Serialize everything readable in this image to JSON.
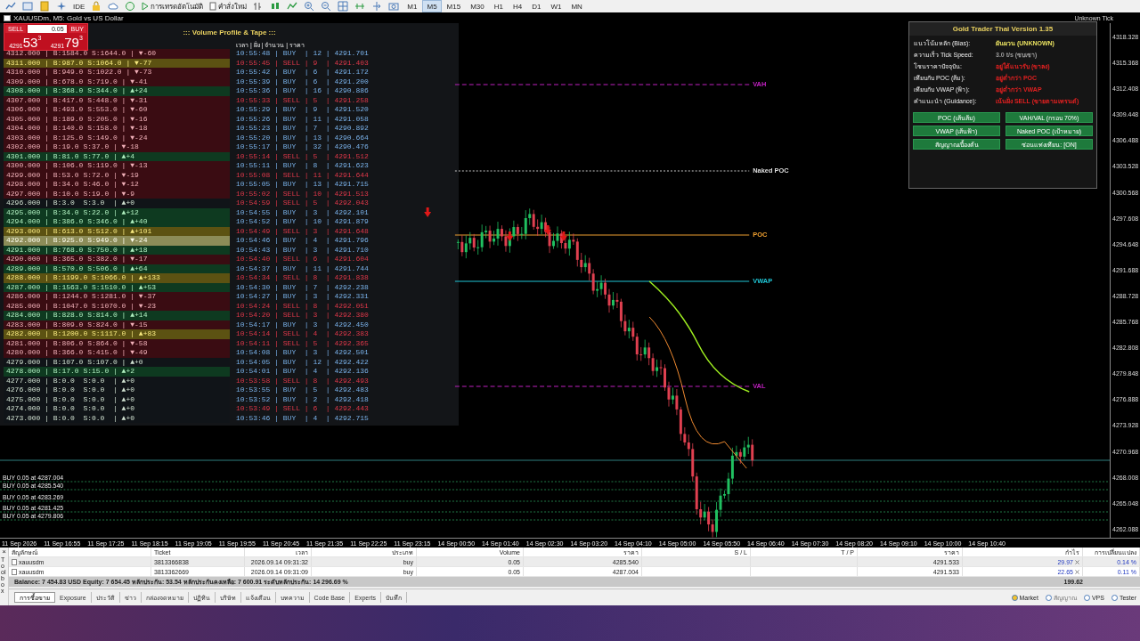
{
  "toolbar": {
    "labeled_buttons": [
      {
        "label": "IDE",
        "kind": "plain"
      },
      {
        "label": "การเทรดอัตโนมัติ",
        "kind": "play"
      },
      {
        "label": "คำสั่งใหม่",
        "kind": "doc"
      }
    ],
    "timeframes": [
      {
        "label": "M1",
        "selected": false
      },
      {
        "label": "M5",
        "selected": true
      },
      {
        "label": "M15",
        "selected": false
      },
      {
        "label": "M30",
        "selected": false
      },
      {
        "label": "H1",
        "selected": false
      },
      {
        "label": "H4",
        "selected": false
      },
      {
        "label": "D1",
        "selected": false
      },
      {
        "label": "W1",
        "selected": false
      },
      {
        "label": "MN",
        "selected": false
      }
    ]
  },
  "chart_window": {
    "title": "XAUUSDm, M5: Gold vs US Dollar",
    "corner_label": "Unknown Tick",
    "one_click": {
      "sell": "SELL",
      "buy": "BUY",
      "volume": "0.05",
      "bid": {
        "big": "4291",
        "main": "53",
        "small": "3"
      },
      "ask": {
        "big": "4291",
        "main": "79",
        "small": "3"
      }
    },
    "volume_panel": {
      "title": "::: Volume Profile & Tape :::",
      "tape_header": "เวลา | ฝั่ง | จำนวน | ราคา",
      "book": [
        {
          "text": "4312.000 | B:1584.0 S:1644.0 | ▼-60",
          "kind": "sell"
        },
        {
          "text": "4311.000 | B:987.0 S:1064.0 | ▼-77",
          "kind": "high"
        },
        {
          "text": "4310.000 | B:949.0 S:1022.0 | ▼-73",
          "kind": "sell"
        },
        {
          "text": "4309.000 | B:678.0 S:719.0 | ▼-41",
          "kind": "sell"
        },
        {
          "text": "4308.000 | B:368.0 S:344.0 | ▲+24",
          "kind": "buy"
        },
        {
          "text": "4307.000 | B:417.0 S:448.0 | ▼-31",
          "kind": "sell"
        },
        {
          "text": "4306.000 | B:493.0 S:553.0 | ▼-60",
          "kind": "sell"
        },
        {
          "text": "4305.000 | B:189.0 S:205.0 | ▼-16",
          "kind": "sell"
        },
        {
          "text": "4304.000 | B:140.0 S:158.0 | ▼-18",
          "kind": "sell"
        },
        {
          "text": "4303.000 | B:125.0 S:149.0 | ▼-24",
          "kind": "sell"
        },
        {
          "text": "4302.000 | B:19.0 S:37.0 | ▼-18",
          "kind": "sell"
        },
        {
          "text": "4301.000 | B:81.0 S:77.0 | ▲+4",
          "kind": "buy"
        },
        {
          "text": "4300.000 | B:106.0 S:119.0 | ▼-13",
          "kind": "sell"
        },
        {
          "text": "4299.000 | B:53.0 S:72.0 | ▼-19",
          "kind": "sell"
        },
        {
          "text": "4298.000 | B:34.0 S:46.0 | ▼-12",
          "kind": "sell"
        },
        {
          "text": "4297.000 | B:10.0 S:19.0 | ▼-9",
          "kind": "sell"
        },
        {
          "text": "4296.000 | B:3.0  S:3.0  | ▲+0",
          "kind": "zero"
        },
        {
          "text": "4295.000 | B:34.0 S:22.0 | ▲+12",
          "kind": "buy"
        },
        {
          "text": "4294.000 | B:386.0 S:346.0 | ▲+40",
          "kind": "buy"
        },
        {
          "text": "4293.000 | B:613.0 S:512.0 | ▲+101",
          "kind": "high"
        },
        {
          "text": "4292.000 | B:925.0 S:949.0 | ▼-24",
          "kind": "current"
        },
        {
          "text": "4291.000 | B:768.0 S:750.0 | ▲+18",
          "kind": "buy"
        },
        {
          "text": "4290.000 | B:365.0 S:382.0 | ▼-17",
          "kind": "sell"
        },
        {
          "text": "4289.000 | B:570.0 S:506.0 | ▲+64",
          "kind": "buy"
        },
        {
          "text": "4288.000 | B:1199.0 S:1066.0 | ▲+133",
          "kind": "high"
        },
        {
          "text": "4287.000 | B:1563.0 S:1510.0 | ▲+53",
          "kind": "buy"
        },
        {
          "text": "4286.000 | B:1244.0 S:1281.0 | ▼-37",
          "kind": "sell"
        },
        {
          "text": "4285.000 | B:1047.0 S:1070.0 | ▼-23",
          "kind": "sell"
        },
        {
          "text": "4284.000 | B:828.0 S:814.0 | ▲+14",
          "kind": "buy"
        },
        {
          "text": "4283.000 | B:809.0 S:824.0 | ▼-15",
          "kind": "sell"
        },
        {
          "text": "4282.000 | B:1200.0 S:1117.0 | ▲+83",
          "kind": "high"
        },
        {
          "text": "4281.000 | B:806.0 S:864.0 | ▼-58",
          "kind": "sell"
        },
        {
          "text": "4280.000 | B:366.0 S:415.0 | ▼-49",
          "kind": "sell"
        },
        {
          "text": "4279.000 | B:107.0 S:107.0 | ▲+0",
          "kind": "zero"
        },
        {
          "text": "4278.000 | B:17.0 S:15.0 | ▲+2",
          "kind": "buy"
        },
        {
          "text": "4277.000 | B:0.0  S:0.0  | ▲+0",
          "kind": "zero"
        },
        {
          "text": "4276.000 | B:0.0  S:0.0  | ▲+0",
          "kind": "zero"
        },
        {
          "text": "4275.000 | B:0.0  S:0.0  | ▲+0",
          "kind": "zero"
        },
        {
          "text": "4274.000 | B:0.0  S:0.0  | ▲+0",
          "kind": "zero"
        },
        {
          "text": "4273.000 | B:0.0  S:0.0  | ▲+0",
          "kind": "zero"
        }
      ],
      "tape": [
        {
          "text": "10:55:48 | BUY  | 12 | 4291.701",
          "kind": "buy"
        },
        {
          "text": "10:55:45 | SELL | 9  | 4291.403",
          "kind": "sell"
        },
        {
          "text": "10:55:42 | BUY  | 6  | 4291.172",
          "kind": "buy"
        },
        {
          "text": "10:55:39 | BUY  | 6  | 4291.200",
          "kind": "buy"
        },
        {
          "text": "10:55:36 | BUY  | 16 | 4290.886",
          "kind": "buy"
        },
        {
          "text": "10:55:33 | SELL | 5  | 4291.258",
          "kind": "sell"
        },
        {
          "text": "10:55:29 | BUY  | 9  | 4291.520",
          "kind": "buy"
        },
        {
          "text": "10:55:26 | BUY  | 11 | 4291.058",
          "kind": "buy"
        },
        {
          "text": "10:55:23 | BUY  | 7  | 4290.892",
          "kind": "buy"
        },
        {
          "text": "10:55:20 | BUY  | 13 | 4290.664",
          "kind": "buy"
        },
        {
          "text": "10:55:17 | BUY  | 32 | 4290.476",
          "kind": "buy"
        },
        {
          "text": "10:55:14 | SELL | 5  | 4291.512",
          "kind": "sell"
        },
        {
          "text": "10:55:11 | BUY  | 8  | 4291.623",
          "kind": "buy"
        },
        {
          "text": "10:55:08 | SELL | 11 | 4291.644",
          "kind": "sell"
        },
        {
          "text": "10:55:05 | BUY  | 13 | 4291.715",
          "kind": "buy"
        },
        {
          "text": "10:55:02 | SELL | 10 | 4291.513",
          "kind": "sell"
        },
        {
          "text": "10:54:59 | SELL | 5  | 4292.043",
          "kind": "sell"
        },
        {
          "text": "10:54:55 | BUY  | 3  | 4292.101",
          "kind": "buy"
        },
        {
          "text": "10:54:52 | BUY  | 10 | 4291.879",
          "kind": "buy"
        },
        {
          "text": "10:54:49 | SELL | 3  | 4291.648",
          "kind": "sell"
        },
        {
          "text": "10:54:46 | BUY  | 4  | 4291.796",
          "kind": "buy"
        },
        {
          "text": "10:54:43 | BUY  | 3  | 4291.710",
          "kind": "buy"
        },
        {
          "text": "10:54:40 | SELL | 6  | 4291.604",
          "kind": "sell"
        },
        {
          "text": "10:54:37 | BUY  | 11 | 4291.744",
          "kind": "buy"
        },
        {
          "text": "10:54:34 | SELL | 8  | 4291.838",
          "kind": "sell"
        },
        {
          "text": "10:54:30 | BUY  | 7  | 4292.238",
          "kind": "buy"
        },
        {
          "text": "10:54:27 | BUY  | 3  | 4292.331",
          "kind": "buy"
        },
        {
          "text": "10:54:24 | SELL | 8  | 4292.051",
          "kind": "sell"
        },
        {
          "text": "10:54:20 | SELL | 3  | 4292.380",
          "kind": "sell"
        },
        {
          "text": "10:54:17 | BUY  | 3  | 4292.450",
          "kind": "buy"
        },
        {
          "text": "10:54:14 | SELL | 4  | 4292.383",
          "kind": "sell"
        },
        {
          "text": "10:54:11 | SELL | 5  | 4292.365",
          "kind": "sell"
        },
        {
          "text": "10:54:08 | BUY  | 3  | 4292.501",
          "kind": "buy"
        },
        {
          "text": "10:54:05 | BUY  | 12 | 4292.422",
          "kind": "buy"
        },
        {
          "text": "10:54:01 | BUY  | 4  | 4292.136",
          "kind": "buy"
        },
        {
          "text": "10:53:58 | SELL | 8  | 4292.493",
          "kind": "sell"
        },
        {
          "text": "10:53:55 | BUY  | 5  | 4292.483",
          "kind": "buy"
        },
        {
          "text": "10:53:52 | BUY  | 2  | 4292.418",
          "kind": "buy"
        },
        {
          "text": "10:53:49 | SELL | 6  | 4292.443",
          "kind": "sell"
        },
        {
          "text": "10:53:46 | BUY  | 4  | 4292.715",
          "kind": "buy"
        }
      ]
    },
    "levels": [
      {
        "label": "VAH",
        "kind": "vah"
      },
      {
        "label": "Naked POC",
        "kind": "naked"
      },
      {
        "label": "POC",
        "kind": "poc"
      },
      {
        "label": "VWAP",
        "kind": "vwap"
      },
      {
        "label": "VAL",
        "kind": "val"
      }
    ],
    "order_lines": [
      {
        "label": "BUY 0.05 at 4287.004"
      },
      {
        "label": "BUY 0.05 at 4285.540"
      },
      {
        "label": "BUY 0.05 at 4283.269"
      },
      {
        "label": "BUY 0.05 at 4281.425"
      },
      {
        "label": "BUY 0.05 at 4279.806"
      }
    ],
    "info_panel": {
      "title": "Gold Trader Thai Version 1.35",
      "rows": [
        {
          "label": "แนวโน้มหลัก (Bias):",
          "value": "ผันผวน (UNKNOWN)",
          "color": "#e8e060"
        },
        {
          "label": "ความเร็ว Tick Speed:",
          "value": "3.0 t/s (ซบเซา)",
          "color": "#9a9a9a"
        },
        {
          "label": "โซนราคาปัจจุบัน:",
          "value": "อยู่ใต้แนวรับ (ขาลง)",
          "color": "#e02020"
        },
        {
          "label": "เทียบกับ POC (ส้ม):",
          "value": "อยู่ต่ำกว่า POC",
          "color": "#e02020"
        },
        {
          "label": "เทียบกับ VWAP (ฟ้า):",
          "value": "อยู่ต่ำกว่า VWAP",
          "color": "#e02020"
        },
        {
          "label": "คำแนะนำ (Guidance):",
          "value": "เน้นฝั่ง SELL (ขายตามเทรนด์)",
          "color": "#e02020"
        }
      ],
      "buttons": [
        "POC (เส้นส้ม)",
        "VAH/VAL (กรอบ 70%)",
        "VWAP (เส้นฟ้า)",
        "Naked POC (เป้าหมาย)",
        "สัญญาณเบื้องต้น",
        "ซ่อนแท่งเทียน: [ON]"
      ]
    },
    "price_axis": [
      "4318.328",
      "4315.368",
      "4312.408",
      "4309.448",
      "4306.488",
      "4303.528",
      "4300.568",
      "4297.608",
      "4294.648",
      "4291.688",
      "4288.728",
      "4285.768",
      "4282.808",
      "4279.848",
      "4276.888",
      "4273.928",
      "4270.968",
      "4268.008",
      "4265.048",
      "4262.088"
    ],
    "time_axis": [
      "11 Sep 2026",
      "11 Sep 16:55",
      "11 Sep 17:25",
      "11 Sep 18:15",
      "11 Sep 19:05",
      "11 Sep 19:55",
      "11 Sep 20:45",
      "11 Sep 21:35",
      "11 Sep 22:25",
      "11 Sep 23:15",
      "14 Sep 00:50",
      "14 Sep 01:40",
      "14 Sep 02:30",
      "14 Sep 03:20",
      "14 Sep 04:10",
      "14 Sep 05:00",
      "14 Sep 05:50",
      "14 Sep 06:40",
      "14 Sep 07:30",
      "14 Sep 08:20",
      "14 Sep 09:10",
      "14 Sep 10:00",
      "14 Sep 10:40"
    ]
  },
  "terminal": {
    "close": "×",
    "side_label": "Toolbox",
    "columns": [
      "สัญลักษณ์",
      "Ticket",
      "เวลา",
      "ประเภท",
      "Volume",
      "ราคา",
      "S / L",
      "T / P",
      "ราคา",
      "กำไร",
      "การเปลี่ยนแปลง"
    ],
    "rows": [
      {
        "selected": true,
        "cells": [
          "xauusdm",
          "3813366838",
          "2026.09.14 09:31:32",
          "buy",
          "0.05",
          "4285.540",
          "",
          "",
          "4291.533",
          "29.97",
          "0.14 %"
        ]
      },
      {
        "selected": false,
        "cells": [
          "xauusdm",
          "3813362669",
          "2026.09.14 09:31:09",
          "buy",
          "0.05",
          "4287.004",
          "",
          "",
          "4291.533",
          "22.65",
          "0.11 %"
        ]
      }
    ],
    "balance": "Balance: 7 454.83 USD  Equity: 7 654.45  หลักประกัน: 53.54  หลักประกันคงเหลือ: 7 600.91  ระดับหลักประกัน: 14 296.69 %",
    "total": "199.62",
    "tabs": [
      {
        "label": "การซื้อขาย",
        "selected": true
      },
      {
        "label": "Exposure",
        "selected": false
      },
      {
        "label": "ประวัติ",
        "selected": false
      },
      {
        "label": "ข่าว",
        "selected": false
      },
      {
        "label": "กล่องจดหมาย",
        "selected": false
      },
      {
        "label": "ปฏิทิน",
        "selected": false
      },
      {
        "label": "บริษัท",
        "selected": false
      },
      {
        "label": "แจ้งเตือน",
        "selected": false
      },
      {
        "label": "บทความ",
        "selected": false
      },
      {
        "label": "Code Base",
        "selected": false
      },
      {
        "label": "Experts",
        "selected": false
      },
      {
        "label": "บันทึก",
        "selected": false
      }
    ],
    "status": [
      "Market",
      "สัญญาณ",
      "VPS",
      "Tester"
    ]
  }
}
